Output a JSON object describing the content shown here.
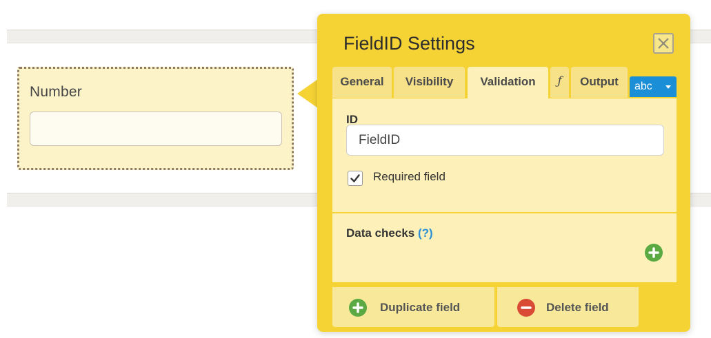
{
  "canvas": {
    "field_label": "Number",
    "field_value": ""
  },
  "panel": {
    "title": "FieldID Settings",
    "tabs": [
      {
        "label": "General",
        "active": false
      },
      {
        "label": "Visibility",
        "active": false
      },
      {
        "label": "Validation",
        "active": true
      },
      {
        "label": "ƒ",
        "active": false
      },
      {
        "label": "Output",
        "active": false
      }
    ],
    "type_badge": "abc",
    "id_label": "ID",
    "id_value": "FieldID",
    "required_label": "Required field",
    "required_checked": true,
    "data_checks_label": "Data checks",
    "data_checks_help": "(?)",
    "duplicate_label": "Duplicate field",
    "delete_label": "Delete field"
  },
  "colors": {
    "panel": "#f5d335",
    "section": "#fdf1b9",
    "field_card": "#fdf3c9",
    "accent_blue": "#1b8ed8",
    "add_green": "#5aa943",
    "delete_red": "#d94b35"
  },
  "icons": {
    "close": "close-icon",
    "dropdown": "chevron-down-icon",
    "checkbox": "checkmark-icon",
    "add": "plus-icon",
    "remove": "minus-icon"
  }
}
